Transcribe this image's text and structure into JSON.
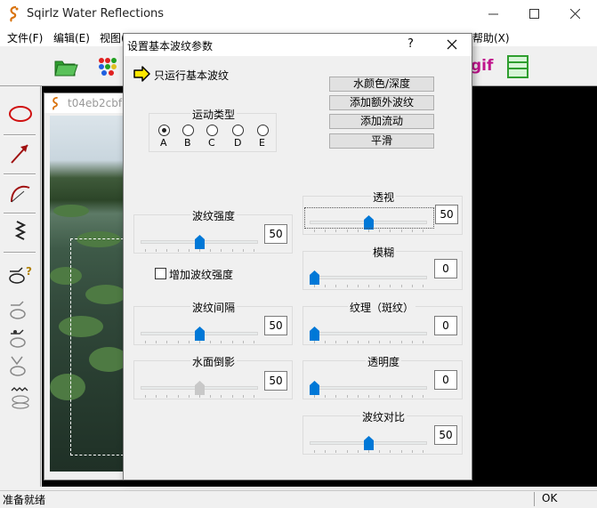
{
  "window": {
    "title": "Sqirlz Water Reflections",
    "menu": [
      "文件(F)",
      "编辑(E)",
      "视图(V)"
    ],
    "menu_tail": "帮助(X)",
    "gif_label": "gif"
  },
  "document": {
    "title": "t04eb2cbf"
  },
  "status": {
    "text": "准备就绪",
    "right": "OK"
  },
  "dialog": {
    "title": "设置基本波纹参数",
    "help": "?",
    "run_basic_label": "只运行基本波纹",
    "buttons": [
      "水颜色/深度",
      "添加额外波纹",
      "添加流动",
      "平滑"
    ],
    "motion": {
      "label": "运动类型",
      "options": [
        "A",
        "B",
        "C",
        "D",
        "E"
      ],
      "selected": "A"
    },
    "add_strength_label": "增加波纹强度",
    "add_strength_checked": false,
    "sliders": [
      {
        "label": "波纹强度",
        "value": 50,
        "min": 0,
        "max": 100,
        "enabled": true
      },
      {
        "label": "波纹间隔",
        "value": 50,
        "min": 0,
        "max": 100,
        "enabled": true
      },
      {
        "label": "水面倒影",
        "value": 50,
        "min": 0,
        "max": 100,
        "enabled": false
      },
      {
        "label": "透视",
        "value": 50,
        "min": 0,
        "max": 100,
        "enabled": true
      },
      {
        "label": "模糊",
        "value": 0,
        "min": 0,
        "max": 100,
        "enabled": true
      },
      {
        "label": "纹理（斑纹）",
        "value": 0,
        "min": 0,
        "max": 100,
        "enabled": true
      },
      {
        "label": "透明度",
        "value": 0,
        "min": 0,
        "max": 100,
        "enabled": true
      },
      {
        "label": "波纹对比",
        "value": 50,
        "min": 0,
        "max": 100,
        "enabled": true
      }
    ]
  },
  "colors": {
    "accent_blue": "#0078d7",
    "disabled_thumb": "#c8c8c8",
    "gif_magenta": "#c0148c"
  }
}
